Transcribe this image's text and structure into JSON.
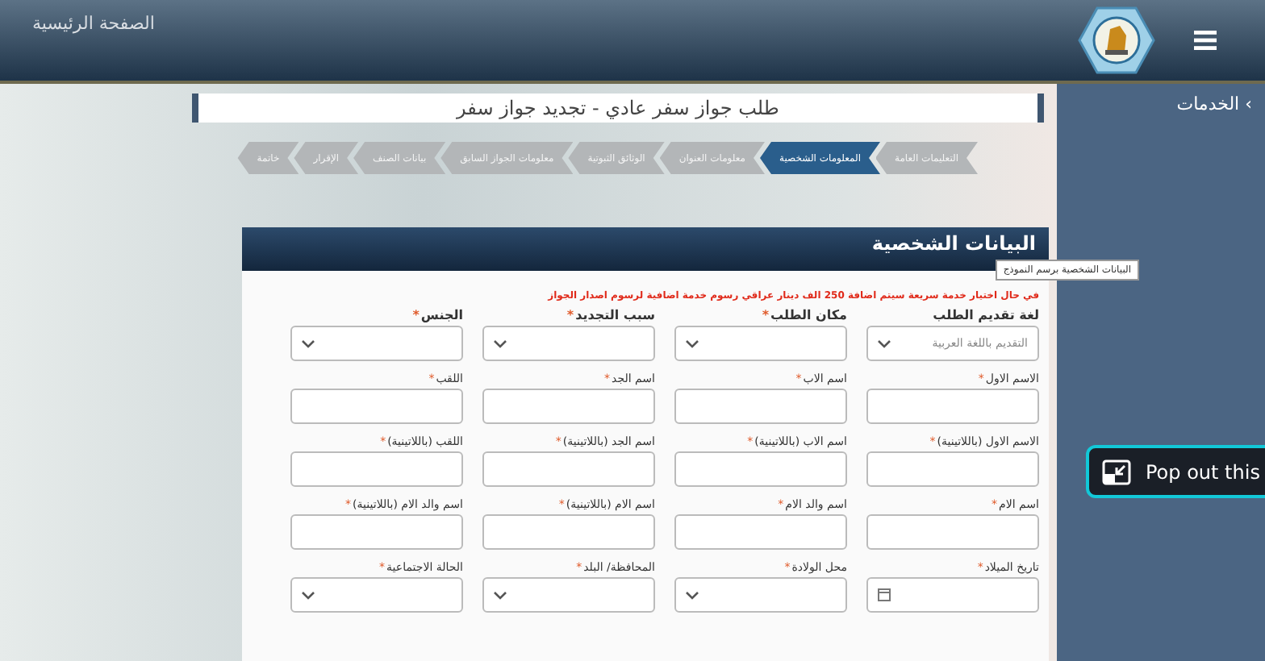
{
  "header": {
    "home_link": "الصفحة الرئيسية"
  },
  "sidebar": {
    "items": [
      {
        "label": "الخدمات",
        "arrow": "›"
      }
    ]
  },
  "page_title": "طلب جواز سفر عادي - تجديد جواز سفر",
  "steps": [
    {
      "label": "التعليمات العامة",
      "selected": false
    },
    {
      "label": "المعلومات الشخصية",
      "selected": true
    },
    {
      "label": "معلومات العنوان",
      "selected": false
    },
    {
      "label": "الوثائق الثبوتية",
      "selected": false
    },
    {
      "label": "معلومات الجواز السابق",
      "selected": false
    },
    {
      "label": "بيانات الصنف",
      "selected": false
    },
    {
      "label": "الإقرار",
      "selected": false
    },
    {
      "label": "خاتمة",
      "selected": false
    }
  ],
  "form": {
    "title": "البيانات الشخصية",
    "tooltip": "البيانات الشخصية برسم النموذج",
    "notice": "في حال اختيار خدمة سريعة سيتم اضافة 250 الف دينار عراقي رسوم خدمة اضافية لرسوم اصدار الجواز",
    "rows": [
      [
        {
          "label": "لغة تقديم الطلب",
          "kind": "select",
          "value": "التقديم باللغة العربية"
        },
        {
          "label": "مكان الطلب",
          "required_mark": "*",
          "kind": "select"
        },
        {
          "label": "سبب التجديد",
          "required_mark": "*",
          "kind": "select"
        },
        {
          "label": "الجنس",
          "required_mark": "*",
          "kind": "select"
        }
      ],
      [
        {
          "label": "الاسم الاول",
          "required_mark": "*",
          "kind": "text"
        },
        {
          "label": "اسم الاب",
          "required_mark": "*",
          "kind": "text"
        },
        {
          "label": "اسم الجد",
          "required_mark": "*",
          "kind": "text"
        },
        {
          "label": "اللقب",
          "required_mark": "*",
          "kind": "text"
        }
      ],
      [
        {
          "label": "الاسم الاول (باللاتينية)",
          "required_mark": "*",
          "kind": "text"
        },
        {
          "label": "اسم الاب (باللاتينية)",
          "required_mark": "*",
          "kind": "text"
        },
        {
          "label": "اسم الجد (باللاتينية)",
          "required_mark": "*",
          "kind": "text"
        },
        {
          "label": "اللقب (باللاتينية)",
          "required_mark": "*",
          "kind": "text"
        }
      ],
      [
        {
          "label": "اسم الام",
          "required_mark": "*",
          "kind": "text"
        },
        {
          "label": "اسم والد الام",
          "required_mark": "*",
          "kind": "text"
        },
        {
          "label": "اسم الام (باللاتينية)",
          "required_mark": "*",
          "kind": "text"
        },
        {
          "label": "اسم والد الام (باللاتينية)",
          "required_mark": "*",
          "kind": "text"
        }
      ],
      [
        {
          "label": "تاريخ الميلاد",
          "required_mark": "*",
          "kind": "date"
        },
        {
          "label": "محل الولادة",
          "required_mark": "*",
          "kind": "select"
        },
        {
          "label": "المحافظة/ البلد",
          "required_mark": "*",
          "kind": "select"
        },
        {
          "label": "الحالة الاجتماعية",
          "required_mark": "*",
          "kind": "select"
        }
      ]
    ]
  },
  "popout": {
    "label": "Pop out this"
  }
}
